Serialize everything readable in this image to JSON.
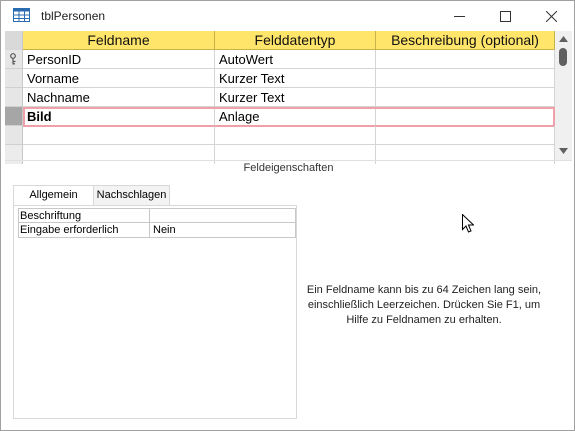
{
  "window": {
    "title": "tblPersonen",
    "icons": {
      "app": "table-icon",
      "minimize": "minimize-icon",
      "maximize": "maximize-icon",
      "close": "close-icon"
    }
  },
  "grid": {
    "columns": [
      "Feldname",
      "Felddatentyp",
      "Beschreibung (optional)"
    ],
    "rows": [
      {
        "field": "PersonID",
        "type": "AutoWert",
        "description": "",
        "primary_key": true
      },
      {
        "field": "Vorname",
        "type": "Kurzer Text",
        "description": ""
      },
      {
        "field": "Nachname",
        "type": "Kurzer Text",
        "description": ""
      },
      {
        "field": "Bild",
        "type": "Anlage",
        "description": "",
        "current": true
      }
    ],
    "key_icon": "primary-key-icon"
  },
  "field_properties": {
    "title": "Feldeigenschaften",
    "tabs": [
      "Allgemein",
      "Nachschlagen"
    ],
    "active_tab": "Allgemein",
    "properties": [
      {
        "label": "Beschriftung",
        "value": ""
      },
      {
        "label": "Eingabe erforderlich",
        "value": "Nein"
      }
    ],
    "help_text": "Ein Feldname kann bis zu 64 Zeichen lang sein, einschließlich Leerzeichen. Drücken Sie F1, um Hilfe zu Feldnamen zu erhalten."
  },
  "colors": {
    "header_bg": "#ffe56a",
    "current_row_outline": "#f0a0a8",
    "selector_current": "#a6a6a6"
  }
}
